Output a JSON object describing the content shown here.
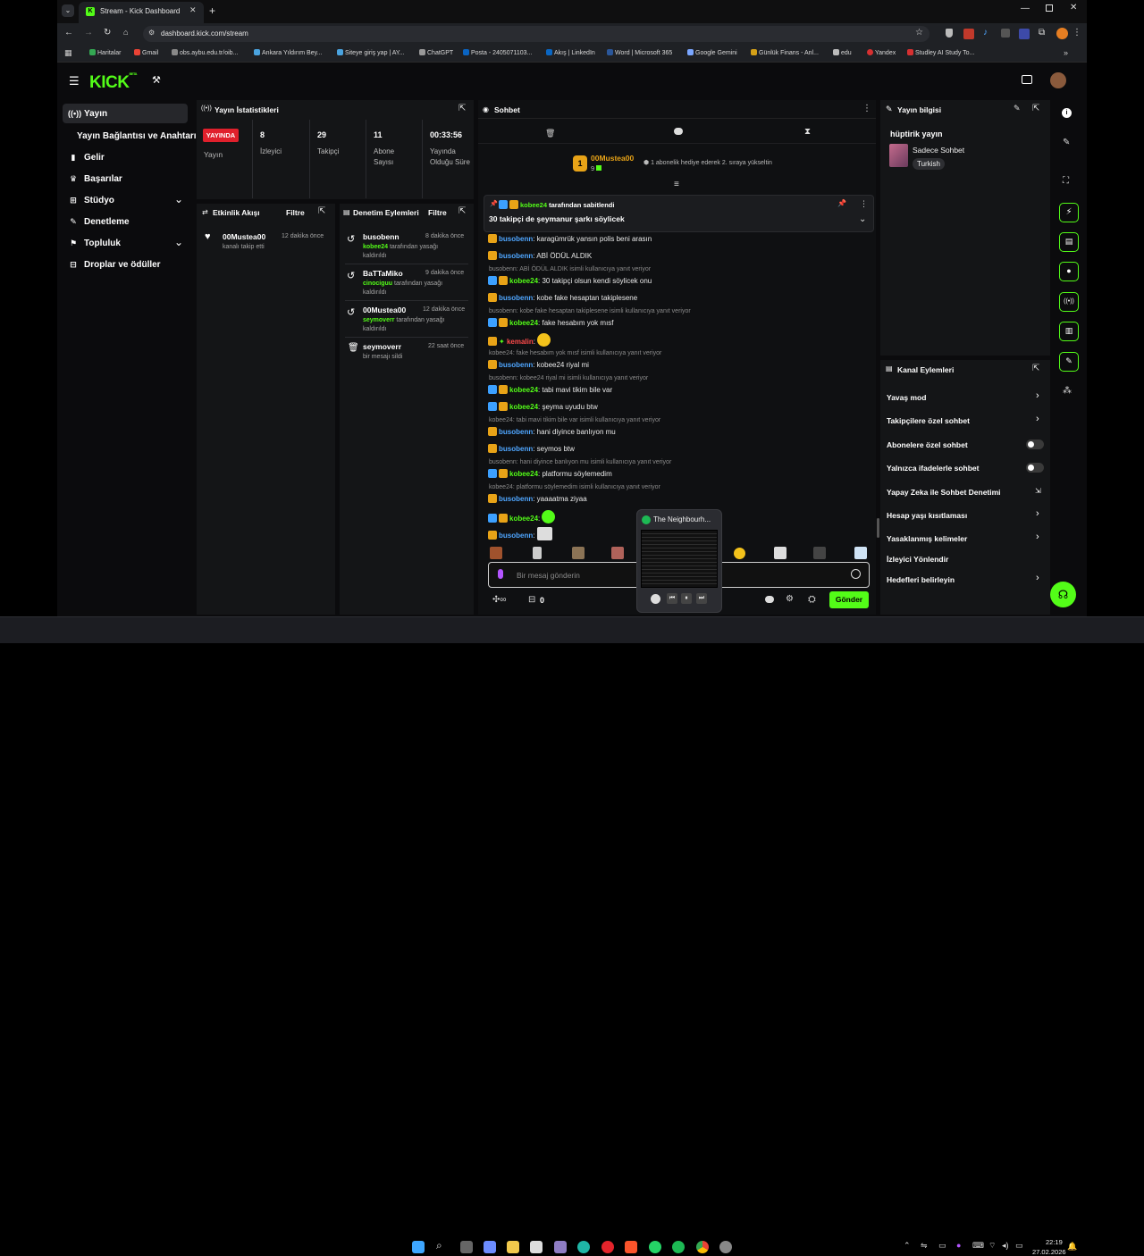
{
  "browser": {
    "tab_title": "Stream - Kick Dashboard",
    "url": "dashboard.kick.com/stream",
    "bookmarks": [
      "Haritalar",
      "Gmail",
      "obs.aybu.edu.tr/oib...",
      "Ankara Yıldırım Bey...",
      "Siteye giriş yap | AY...",
      "ChatGPT",
      "Posta - 2405071103...",
      "Akış | LinkedIn",
      "Word | Microsoft 365",
      "Google Gemini",
      "Günlük Finans - Anl...",
      "edu",
      "Yandex",
      "Studley AI Study To..."
    ]
  },
  "header": {
    "logo": "KICK",
    "logo_sup": "BETA"
  },
  "sidebar": {
    "items": [
      {
        "label": "Yayın",
        "icon": "broadcast-icon"
      },
      {
        "label": "Yayın Bağlantısı ve Anahtarı",
        "icon": ""
      },
      {
        "label": "Gelir",
        "icon": "bar-chart-icon"
      },
      {
        "label": "Başarılar",
        "icon": "trophy-icon"
      },
      {
        "label": "Stüdyo",
        "icon": "studio-icon"
      },
      {
        "label": "Denetleme",
        "icon": "wrench-icon"
      },
      {
        "label": "Topluluk",
        "icon": "community-icon"
      },
      {
        "label": "Droplar ve ödüller",
        "icon": "gift-icon"
      }
    ]
  },
  "stats": {
    "title": "Yayın İstatistikleri",
    "live_badge": "YAYINDA",
    "live_label": "Yayın",
    "items": [
      {
        "value": "8",
        "label": "İzleyici"
      },
      {
        "value": "29",
        "label": "Takipçi"
      },
      {
        "value": "11",
        "label": "Abone Sayısı"
      },
      {
        "value": "00:33:56",
        "label": "Yayında Olduğu Süre"
      }
    ]
  },
  "activity": {
    "title": "Etkinlik Akışı",
    "filter": "Filtre",
    "items": [
      {
        "user": "00Mustea00",
        "time": "12 dakika önce",
        "text": "kanalı takip etti"
      }
    ]
  },
  "moderation": {
    "title": "Denetim Eylemleri",
    "filter": "Filtre",
    "items": [
      {
        "user": "busobenn",
        "time": "8 dakika önce",
        "by": "kobee24",
        "text": "tarafından yasağı kaldırıldı"
      },
      {
        "user": "BaTTaMiko",
        "time": "9 dakika önce",
        "by": "cinociguu",
        "text": "tarafından yasağı kaldırıldı"
      },
      {
        "user": "00Mustea00",
        "time": "12 dakika önce",
        "by": "seymoverr",
        "text": "tarafından yasağı kaldırıldı"
      },
      {
        "user": "seymoverr",
        "time": "22 saat önce",
        "by": "",
        "text": "bir mesajı sildi"
      }
    ]
  },
  "chat": {
    "title": "Sohbet",
    "gift_user": "00Mustea00",
    "gift_count": "9",
    "gift_rank": "1",
    "gift_text": "1 abonelik hediye ederek 2. sıraya yükseltin",
    "pinned_by": "kobee24",
    "pinned_by_text": "tarafından sabitlendi",
    "pinned_msg": "30 takipçi de şeymanur şarkı söylicek",
    "messages": [
      {
        "user": "busobenn",
        "text": "karagümrük yansın polis beni arasın"
      },
      {
        "user": "busobenn",
        "text": "ABİ ÖDÜL ALDIK"
      },
      {
        "reply": "busobenn: ABİ ÖDÜL ALDIK isimli kullanıcıya yanıt veriyor",
        "user": "kobee24",
        "text": "30 takipçi olsun kendi söylicek onu"
      },
      {
        "user": "busobenn",
        "text": "kobe fake hesaptan takiplesene"
      },
      {
        "reply": "busobenn: kobe fake hesaptan takiplesene isimli kullanıcıya yanıt veriyor",
        "user": "kobee24",
        "text": "fake hesabım yok mısf"
      },
      {
        "user": "kemalin",
        "text": ""
      },
      {
        "reply": "kobee24: fake hesabım yok mısf isimli kullanıcıya yanıt veriyor",
        "user": "busobenn",
        "text": "kobee24 riyal mi"
      },
      {
        "reply": "busobenn: kobee24 riyal mi isimli kullanıcıya yanıt veriyor",
        "user": "kobee24",
        "text": "tabi mavi tikim bile var"
      },
      {
        "user": "kobee24",
        "text": "şeyma uyudu btw"
      },
      {
        "reply": "kobee24: tabi mavi tikim bile var isimli kullanıcıya yanıt veriyor",
        "user": "busobenn",
        "text": "hani diyince banlıyon mu"
      },
      {
        "user": "busobenn",
        "text": "seymos btw"
      },
      {
        "reply": "busobenn: hani diyince banlıyon mu isimli kullanıcıya yanıt veriyor",
        "user": "kobee24",
        "text": "platformu söylemedim"
      },
      {
        "reply": "kobee24: platformu söylemedim isimli kullanıcıya yanıt veriyor",
        "user": "busobenn",
        "text": "yaaaatma ziyaa"
      },
      {
        "user": "kobee24",
        "text": ""
      },
      {
        "user": "busobenn",
        "text": ""
      }
    ],
    "input_placeholder": "Bir mesaj gönderin",
    "send_label": "Gönder",
    "points": "0"
  },
  "spotify_popup": {
    "title": "The Neighbourh..."
  },
  "stream_info": {
    "title": "Yayın bilgisi",
    "stream_title": "hüptirik yayın",
    "category": "Sadece Sohbet",
    "language": "Turkish"
  },
  "channel_actions": {
    "title": "Kanal Eylemleri",
    "items": [
      {
        "label": "Yavaş mod",
        "control": "chevron"
      },
      {
        "label": "Takipçilere özel sohbet",
        "control": "chevron"
      },
      {
        "label": "Abonelere özel sohbet",
        "control": "toggle"
      },
      {
        "label": "Yalnızca ifadelerle sohbet",
        "control": "toggle"
      },
      {
        "label": "Yapay Zeka ile Sohbet Denetimi",
        "control": "external"
      },
      {
        "label": "Hesap yaşı kısıtlaması",
        "control": "chevron"
      },
      {
        "label": "Yasaklanmış kelimeler",
        "control": "chevron"
      },
      {
        "label": "İzleyici Yönlendir",
        "control": "none"
      },
      {
        "label": "Hedefleri belirleyin",
        "control": "chevron"
      }
    ]
  },
  "taskbar": {
    "time": "22:19",
    "date": "27.02.2026"
  },
  "colors": {
    "brand": "#53fc18",
    "live": "#e0202c",
    "bg": "#0b0b0d",
    "panel": "#141517"
  }
}
